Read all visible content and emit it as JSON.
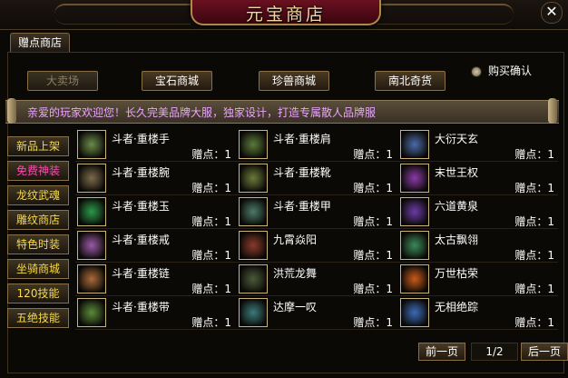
{
  "window": {
    "title": "元宝商店",
    "close_icon": "close-icon"
  },
  "tab": {
    "label": "赠点商店"
  },
  "categories": [
    {
      "label": "大卖场",
      "disabled": true
    },
    {
      "label": "宝石商城",
      "disabled": false
    },
    {
      "label": "珍兽商城",
      "disabled": false
    },
    {
      "label": "南北奇货",
      "disabled": false
    }
  ],
  "confirm": {
    "label": "购买确认"
  },
  "marquee": {
    "text": "亲爱的玩家欢迎您！长久完美品牌大服，独家设计，打造专属散人品牌服"
  },
  "sidebar": [
    {
      "label": "新品上架",
      "active": false
    },
    {
      "label": "免费神装",
      "active": true
    },
    {
      "label": "龙纹武魂",
      "active": false
    },
    {
      "label": "雕纹商店",
      "active": false
    },
    {
      "label": "特色时装",
      "active": false
    },
    {
      "label": "坐骑商城",
      "active": false
    },
    {
      "label": "120技能",
      "active": false
    },
    {
      "label": "五绝技能",
      "active": false
    }
  ],
  "items": [
    {
      "name": "斗者·重楼手",
      "price": "赠点：1",
      "icon": "gauntlet-icon",
      "color": "#6a8a4a"
    },
    {
      "name": "斗者·重楼肩",
      "price": "赠点：1",
      "icon": "shoulder-armor-icon",
      "color": "#5a7a3a"
    },
    {
      "name": "大衍天玄",
      "price": "赠点：1",
      "icon": "staff-weapon-icon",
      "color": "#4a6aa8"
    },
    {
      "name": "斗者·重楼腕",
      "price": "赠点：1",
      "icon": "bracer-icon",
      "color": "#7a6a4a"
    },
    {
      "name": "斗者·重楼靴",
      "price": "赠点：1",
      "icon": "boots-icon",
      "color": "#6a7a3a"
    },
    {
      "name": "末世王权",
      "price": "赠点：1",
      "icon": "scepter-icon",
      "color": "#8a3aa8"
    },
    {
      "name": "斗者·重楼玉",
      "price": "赠点：1",
      "icon": "jade-icon",
      "color": "#2a9a4a"
    },
    {
      "name": "斗者·重楼甲",
      "price": "赠点：1",
      "icon": "armor-icon",
      "color": "#4a7a6a"
    },
    {
      "name": "六道黄泉",
      "price": "赠点：1",
      "icon": "spear-icon",
      "color": "#6a3aa8"
    },
    {
      "name": "斗者·重楼戒",
      "price": "赠点：1",
      "icon": "ring-icon",
      "color": "#9a5aa8"
    },
    {
      "name": "九霄焱阳",
      "price": "赠点：1",
      "icon": "blade-icon",
      "color": "#8a3a2a"
    },
    {
      "name": "太古飘翎",
      "price": "赠点：1",
      "icon": "feather-fan-icon",
      "color": "#3a8a5a"
    },
    {
      "name": "斗者·重楼链",
      "price": "赠点：1",
      "icon": "necklace-icon",
      "color": "#aa6a3a"
    },
    {
      "name": "洪荒龙舞",
      "price": "赠点：1",
      "icon": "dragon-sword-icon",
      "color": "#4a5a3a"
    },
    {
      "name": "万世枯荣",
      "price": "赠点：1",
      "icon": "flame-weapon-icon",
      "color": "#c85a1a"
    },
    {
      "name": "斗者·重楼带",
      "price": "赠点：1",
      "icon": "belt-icon",
      "color": "#5a8a3a"
    },
    {
      "name": "达摩一叹",
      "price": "赠点：1",
      "icon": "prayer-beads-icon",
      "color": "#3a7a7a"
    },
    {
      "name": "无相绝踪",
      "price": "赠点：1",
      "icon": "crystal-blade-icon",
      "color": "#3a6ab8"
    }
  ],
  "pagination": {
    "prev": "前一页",
    "page": "1/2",
    "next": "后一页"
  }
}
